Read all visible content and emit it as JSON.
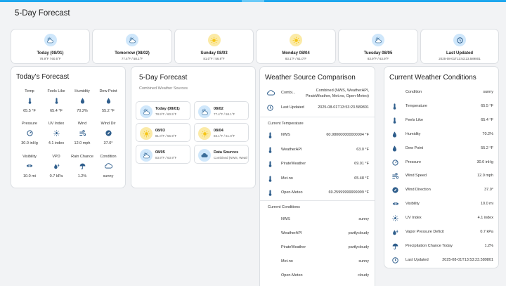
{
  "page_title": "5-Day Forecast",
  "colors": {
    "accent": "#1ea7ee",
    "icon": "#2f5e8c",
    "cloud_bg": "#cfe7fb",
    "sun_bg": "#fbeaa6"
  },
  "top_cards": [
    {
      "title": "Today (08/01)",
      "temps": "78.9°F / 60.5°F",
      "icon": "partly-cloudy-icon"
    },
    {
      "title": "Tomorrow (08/02)",
      "temps": "77.4°F / 58.1°F",
      "icon": "partly-cloudy-icon"
    },
    {
      "title": "Sunday 08/03",
      "temps": "81.0°F / 56.9°F",
      "icon": "sun-icon"
    },
    {
      "title": "Monday 08/04",
      "temps": "83.1°F / 61.0°F",
      "icon": "sun-icon"
    },
    {
      "title": "Tuesday 08/05",
      "temps": "83.9°F / 63.9°F",
      "icon": "partly-cloudy-icon"
    },
    {
      "title": "Last Updated",
      "temps": "2025-08-01T13:53:23.589801",
      "icon": "clock-icon"
    }
  ],
  "today": {
    "title": "Today's Forecast",
    "items": [
      {
        "label": "Temp",
        "value": "65.5 °F",
        "icon": "thermometer-icon"
      },
      {
        "label": "Feels Like",
        "value": "65.4 °F",
        "icon": "thermometer-icon"
      },
      {
        "label": "Humidity",
        "value": "70.2%",
        "icon": "droplet-icon"
      },
      {
        "label": "Dew Point",
        "value": "55.2 °F",
        "icon": "droplet-icon"
      },
      {
        "label": "Pressure",
        "value": "30.0 inHg",
        "icon": "gauge-icon"
      },
      {
        "label": "UV Index",
        "value": "4.1 index",
        "icon": "uv-icon"
      },
      {
        "label": "Wind",
        "value": "12.0 mph",
        "icon": "wind-icon"
      },
      {
        "label": "Wind Dir",
        "value": "37.0°",
        "icon": "compass-icon"
      },
      {
        "label": "Visibility",
        "value": "10.0 mi",
        "icon": "eye-icon"
      },
      {
        "label": "VPD",
        "value": "0.7 kPa",
        "icon": "vpd-icon"
      },
      {
        "label": "Rain Chance",
        "value": "1.2%",
        "icon": "rain-icon"
      },
      {
        "label": "Condition",
        "value": "sunny",
        "icon": "cloud-icon"
      }
    ]
  },
  "forecast": {
    "title": "5-Day Forecast",
    "subtitle": "Combined Weather Sources",
    "tiles": [
      {
        "title": "Today (08/01)",
        "temps": "78.9°F / 60.5°F",
        "icon": "partly-cloudy-icon"
      },
      {
        "title": "08/02",
        "temps": "77.4°F / 58.1°F",
        "icon": "partly-cloudy-icon"
      },
      {
        "title": "08/03",
        "temps": "81.0°F / 56.9°F",
        "icon": "sun-icon"
      },
      {
        "title": "08/04",
        "temps": "83.1°F / 61.0°F",
        "icon": "sun-icon"
      },
      {
        "title": "08/05",
        "temps": "83.9°F / 63.9°F",
        "icon": "partly-cloudy-icon"
      },
      {
        "title": "Data Sources",
        "temps": "Combined (NWS, WeatherAPI, PirateWeather, Met.no, Open-Meteo)",
        "icon": "cloud-icon"
      }
    ]
  },
  "comparison": {
    "title": "Weather Source Comparison",
    "combined_label": "Combi...",
    "combined_value_1": "Combined (NWS, WeatherAPI,",
    "combined_value_2": "PirateWeather, Met.no, Open-Meteo)",
    "last_updated_label": "Last Updated",
    "last_updated_value": "2025-08-01T13:53:23.589801",
    "temp_header": "Current Temperature",
    "temps": [
      {
        "label": "NWS",
        "value": "60.980000000000004 °F"
      },
      {
        "label": "WeatherAPI",
        "value": "63.0 °F"
      },
      {
        "label": "PirateWeather",
        "value": "69.01 °F"
      },
      {
        "label": "Met.no",
        "value": "65.48 °F"
      },
      {
        "label": "Open-Meteo",
        "value": "69.25999999999999 °F"
      }
    ],
    "cond_header": "Current Conditions",
    "conditions": [
      {
        "label": "NWS",
        "value": "sunny"
      },
      {
        "label": "WeatherAPI",
        "value": "partlycloudy"
      },
      {
        "label": "PirateWeather",
        "value": "partlycloudy"
      },
      {
        "label": "Met.no",
        "value": "sunny"
      },
      {
        "label": "Open-Meteo",
        "value": "cloudy"
      }
    ]
  },
  "current": {
    "title": "Current Weather Conditions",
    "rows": [
      {
        "label": "Condition",
        "value": "sunny",
        "icon": ""
      },
      {
        "label": "Temperature",
        "value": "65.5 °F",
        "icon": "thermometer-icon"
      },
      {
        "label": "Feels Like",
        "value": "65.4 °F",
        "icon": "thermometer-icon"
      },
      {
        "label": "Humidity",
        "value": "70.2%",
        "icon": "droplet-icon"
      },
      {
        "label": "Dew Point",
        "value": "55.2 °F",
        "icon": "droplet-icon"
      },
      {
        "label": "Pressure",
        "value": "30.0 inHg",
        "icon": "gauge-icon"
      },
      {
        "label": "Wind Speed",
        "value": "12.0 mph",
        "icon": "wind-icon"
      },
      {
        "label": "Wind Direction",
        "value": "37.0°",
        "icon": "compass-icon"
      },
      {
        "label": "Visibility",
        "value": "10.0 mi",
        "icon": "eye-icon"
      },
      {
        "label": "UV Index",
        "value": "4.1 index",
        "icon": "uv-icon"
      },
      {
        "label": "Vapor Pressure Deficit",
        "value": "0.7 kPa",
        "icon": "vpd-icon"
      },
      {
        "label": "Precipitation Chance Today",
        "value": "1.2%",
        "icon": "rain-icon"
      },
      {
        "label": "Last Updated",
        "value": "2025-08-01T13:53:23.589801",
        "icon": "clock-icon"
      }
    ]
  }
}
